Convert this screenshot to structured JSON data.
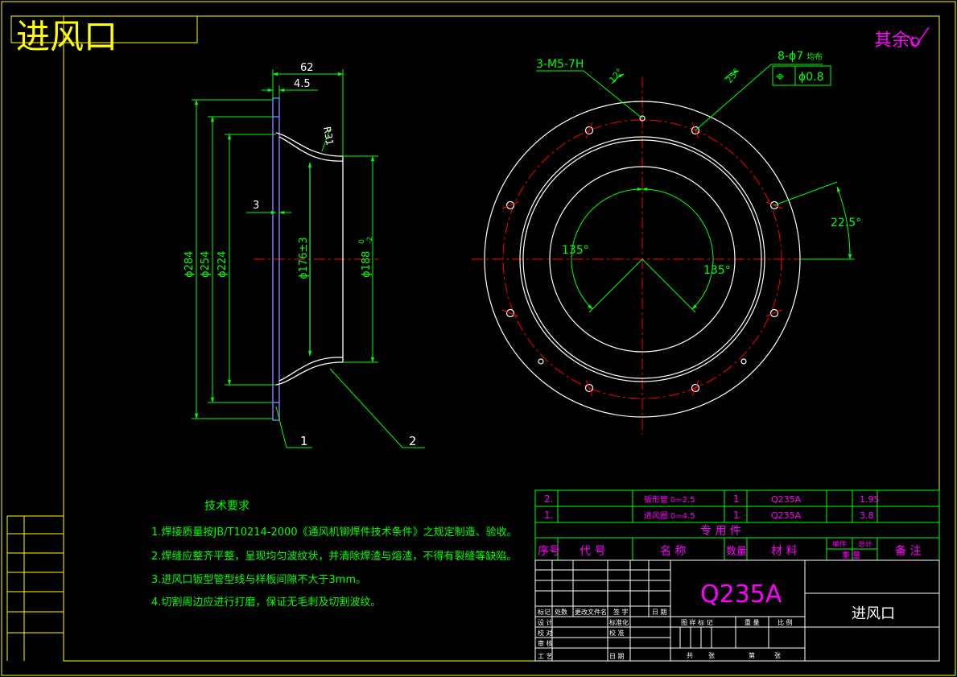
{
  "sheet": {
    "title": "进风口",
    "roughness_note": "其余:"
  },
  "front_view": {
    "dims": {
      "overall_width": "62",
      "flange_thickness": "4.5",
      "radius": "R31",
      "plate_gap": "3",
      "d284": "ϕ284",
      "d254": "ϕ254",
      "d224": "ϕ224",
      "d176": "ϕ176±3",
      "d188": "ϕ188",
      "d188_tol_upper": "0",
      "d188_tol_lower": "-2"
    },
    "balloons": [
      "1",
      "2"
    ]
  },
  "side_view": {
    "thread_callout": "3-M5-7H",
    "hole_callout_count": "8-ϕ7",
    "hole_callout_note": "均布",
    "position_symbol": "⌖",
    "position_tol_dia": "ϕ",
    "position_tol_value": "0.8",
    "angle_a": "135°",
    "angle_b": "135°",
    "angle_c": "22.5°",
    "angle_d": "25°",
    "angle_e": "12°"
  },
  "tech_requirements": {
    "heading": "技术要求",
    "items": [
      "1.焊接质量按JB/T10214-2000《通风机铆焊件技术条件》之规定制造、验收。",
      "2.焊缝应整齐平整，呈现均匀波纹状，并清除焊渣与熔渣，不得有裂缝等缺陷。",
      "3.进风口钣型管型线与样板间隙不大于3mm。",
      "4.切割周边应进行打磨，保证无毛刺及切割波纹。"
    ]
  },
  "parts_list": {
    "rows": [
      {
        "no": "2.",
        "code": "",
        "name": "钣形管 δ=2.5",
        "qty": "1",
        "material": "Q235A",
        "weight": "1.95"
      },
      {
        "no": "1.",
        "code": "",
        "name": "进风圈 δ=4.5",
        "qty": "1",
        "material": "Q235A",
        "weight": "3.8"
      }
    ],
    "group_label": "专 用 件",
    "headers": {
      "no": "序号",
      "code": "代 号",
      "name": "名 称",
      "qty": "数量",
      "material": "材 料",
      "unit_weight": "单件",
      "total_weight": "总计",
      "weight": "重 量",
      "remark": "备 注"
    }
  },
  "title_block": {
    "material": "Q235A",
    "drawing_name": "进风口",
    "rev_headers": [
      "标记",
      "处数",
      "更改文件名",
      "签 字",
      "日 期"
    ],
    "roles_left": [
      "设 计",
      "校 对",
      "审 核",
      "工 艺"
    ],
    "roles_mid": [
      "标准化",
      "校 准",
      "",
      "日 期"
    ],
    "stage_headers": [
      "图 样 标 记",
      "重 量",
      "比 例"
    ],
    "sheet_footer": [
      "共",
      "张",
      "第",
      "张"
    ]
  },
  "colors": {
    "border": "#ffff00",
    "outline": "#ffffff",
    "dimension": "#00ff00",
    "centerline": "#ff0000",
    "annotation": "#ff00ff",
    "pipe": "#8080ff"
  }
}
